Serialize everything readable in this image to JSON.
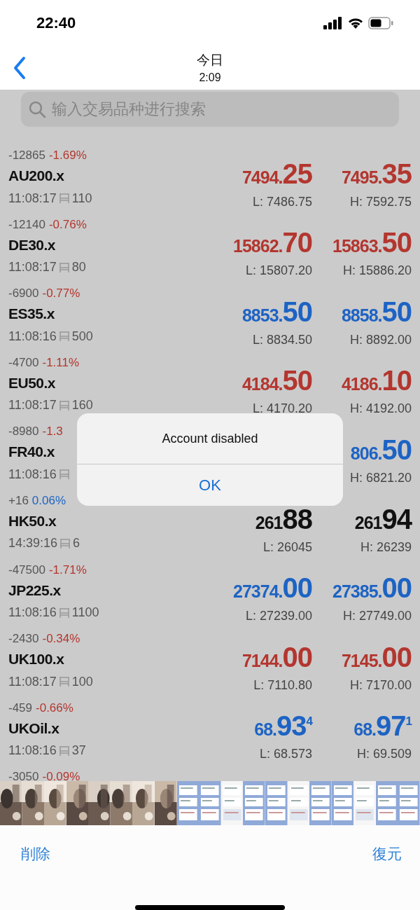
{
  "status_bar": {
    "time": "22:40"
  },
  "nav": {
    "title": "今日",
    "subtitle": "2:09"
  },
  "search": {
    "placeholder": "输入交易品种进行搜索"
  },
  "quotes": [
    {
      "change": "-12865",
      "percent": "-1.69%",
      "color": "#b3362f",
      "symbol": "AU200.x",
      "time": "11:08:17",
      "volume": "110",
      "bid": {
        "main": "7494.",
        "big": "25",
        "color": "#b3362f"
      },
      "ask": {
        "main": "7495.",
        "big": "35",
        "color": "#b3362f"
      },
      "low": "L: 7486.75",
      "high": "H: 7592.75"
    },
    {
      "change": "-12140",
      "percent": "-0.76%",
      "color": "#b3362f",
      "symbol": "DE30.x",
      "time": "11:08:17",
      "volume": "80",
      "bid": {
        "main": "15862.",
        "big": "70",
        "color": "#b3362f"
      },
      "ask": {
        "main": "15863.",
        "big": "50",
        "color": "#b3362f"
      },
      "low": "L: 15807.20",
      "high": "H: 15886.20"
    },
    {
      "change": "-6900",
      "percent": "-0.77%",
      "color": "#b3362f",
      "symbol": "ES35.x",
      "time": "11:08:16",
      "volume": "500",
      "bid": {
        "main": "8853.",
        "big": "50",
        "color": "#1d63c4"
      },
      "ask": {
        "main": "8858.",
        "big": "50",
        "color": "#1d63c4"
      },
      "low": "L: 8834.50",
      "high": "H: 8892.00"
    },
    {
      "change": "-4700",
      "percent": "-1.11%",
      "color": "#b3362f",
      "symbol": "EU50.x",
      "time": "11:08:17",
      "volume": "160",
      "bid": {
        "main": "4184.",
        "big": "50",
        "color": "#b3362f"
      },
      "ask": {
        "main": "4186.",
        "big": "10",
        "color": "#b3362f"
      },
      "low": "L: 4170.20",
      "high": "H: 4192.00"
    },
    {
      "change": "-8980",
      "percent": "-1.3",
      "color": "#b3362f",
      "symbol": "FR40.x",
      "time": "11:08:16",
      "ask": {
        "main": "806.",
        "big": "50",
        "color": "#1d63c4"
      },
      "high": "H: 6821.20"
    },
    {
      "change": "+16",
      "percent": "0.06%",
      "color": "#1d63c4",
      "symbol": "HK50.x",
      "time": "14:39:16",
      "volume": "6",
      "bid": {
        "main": "261",
        "big": "88",
        "color": "#111111"
      },
      "ask": {
        "main": "261",
        "big": "94",
        "color": "#111111"
      },
      "low": "L: 26045",
      "high": "H: 26239"
    },
    {
      "change": "-47500",
      "percent": "-1.71%",
      "color": "#b3362f",
      "symbol": "JP225.x",
      "time": "11:08:16",
      "volume": "1100",
      "bid": {
        "main": "27374.",
        "big": "00",
        "color": "#1d63c4"
      },
      "ask": {
        "main": "27385.",
        "big": "00",
        "color": "#1d63c4"
      },
      "low": "L: 27239.00",
      "high": "H: 27749.00"
    },
    {
      "change": "-2430",
      "percent": "-0.34%",
      "color": "#b3362f",
      "symbol": "UK100.x",
      "time": "11:08:17",
      "volume": "100",
      "bid": {
        "main": "7144.",
        "big": "00",
        "color": "#b3362f"
      },
      "ask": {
        "main": "7145.",
        "big": "00",
        "color": "#b3362f"
      },
      "low": "L: 7110.80",
      "high": "H: 7170.00"
    },
    {
      "change": "-459",
      "percent": "-0.66%",
      "color": "#b3362f",
      "symbol": "UKOil.x",
      "time": "11:08:16",
      "volume": "37",
      "bid": {
        "main": "68.",
        "big": "93",
        "sup": "4",
        "color": "#1d63c4"
      },
      "ask": {
        "main": "68.",
        "big": "97",
        "sup": "1",
        "color": "#1d63c4"
      },
      "low": "L: 68.573",
      "high": "H: 69.509"
    },
    {
      "change": "-3050",
      "percent": "-0.09%",
      "color": "#b3362f"
    }
  ],
  "alert": {
    "message": "Account disabled",
    "button": "OK"
  },
  "toolbar": {
    "left": "削除",
    "right": "復元"
  }
}
